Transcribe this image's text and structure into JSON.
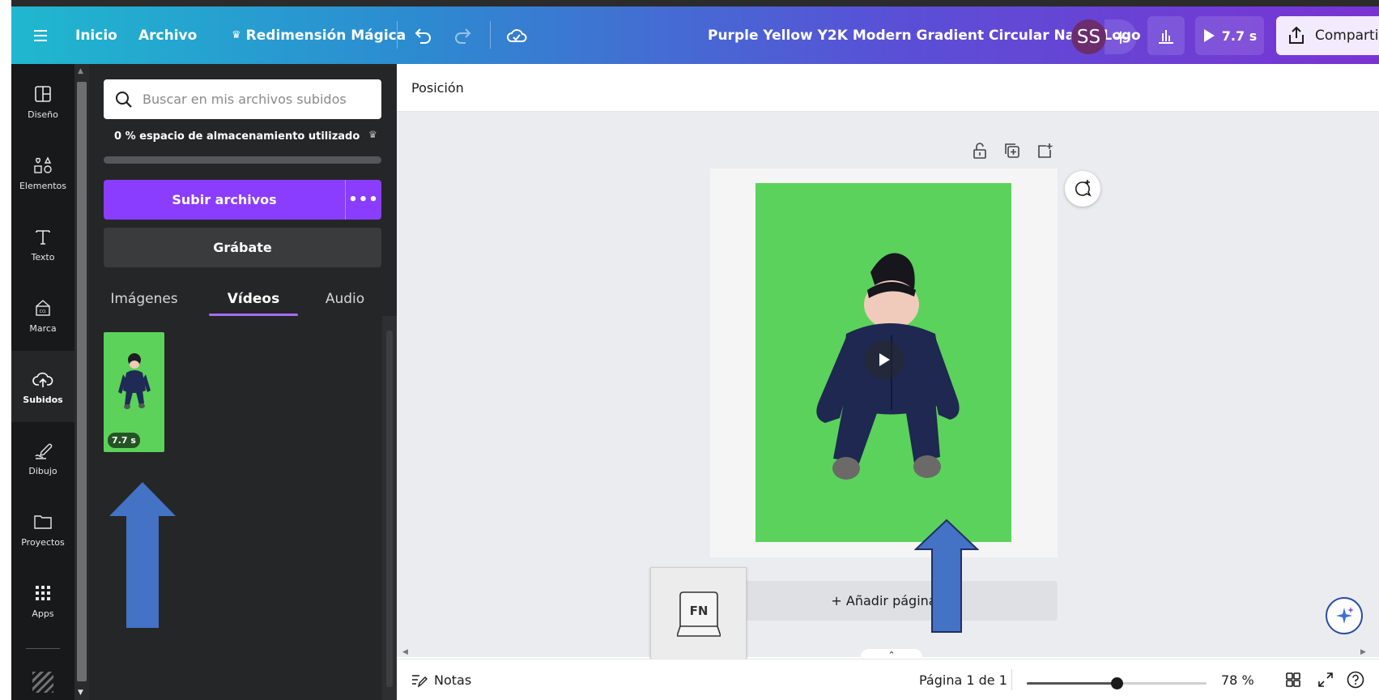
{
  "header": {
    "home_label": "Inicio",
    "file_label": "Archivo",
    "magic_resize_label": "Redimensión Mágica",
    "doc_title": "Purple Yellow Y2K Modern Gradient Circular Name Logo",
    "avatar_initials": "SS",
    "play_duration": "7.7 s",
    "share_label": "Compartir",
    "gradient_start": "#1fb8cf",
    "gradient_end": "#7a33d3"
  },
  "rail": {
    "items": [
      {
        "label": "Diseño",
        "icon": "layout-icon"
      },
      {
        "label": "Elementos",
        "icon": "shapes-icon"
      },
      {
        "label": "Texto",
        "icon": "text-icon"
      },
      {
        "label": "Marca",
        "icon": "brand-icon"
      },
      {
        "label": "Subidos",
        "icon": "cloud-upload-icon"
      },
      {
        "label": "Dibujo",
        "icon": "draw-icon"
      },
      {
        "label": "Proyectos",
        "icon": "folder-icon"
      },
      {
        "label": "Apps",
        "icon": "apps-grid-icon"
      }
    ],
    "active": "Subidos"
  },
  "panel": {
    "search_placeholder": "Buscar en mis archivos subidos",
    "storage_text": "0 % espacio de almacenamiento utilizado",
    "storage_used": 0,
    "upload_label": "Subir archivos",
    "record_label": "Grábate",
    "tabs": [
      {
        "label": "Imágenes"
      },
      {
        "label": "Vídeos"
      },
      {
        "label": "Audio"
      }
    ],
    "active_tab": "Vídeos",
    "accent_color": "#8b3dff",
    "video_thumb": {
      "duration": "7.7 s",
      "background": "#5dd25a"
    }
  },
  "editor": {
    "toolbar_position_label": "Posición",
    "add_page_label": "+ Añadir página",
    "fn_key_label": "FN",
    "canvas_color": "#5bd25b"
  },
  "statusbar": {
    "notes_label": "Notas",
    "page_indicator": "Página 1 de 1",
    "zoom_percent": "78 %",
    "zoom_level": 0.5
  }
}
